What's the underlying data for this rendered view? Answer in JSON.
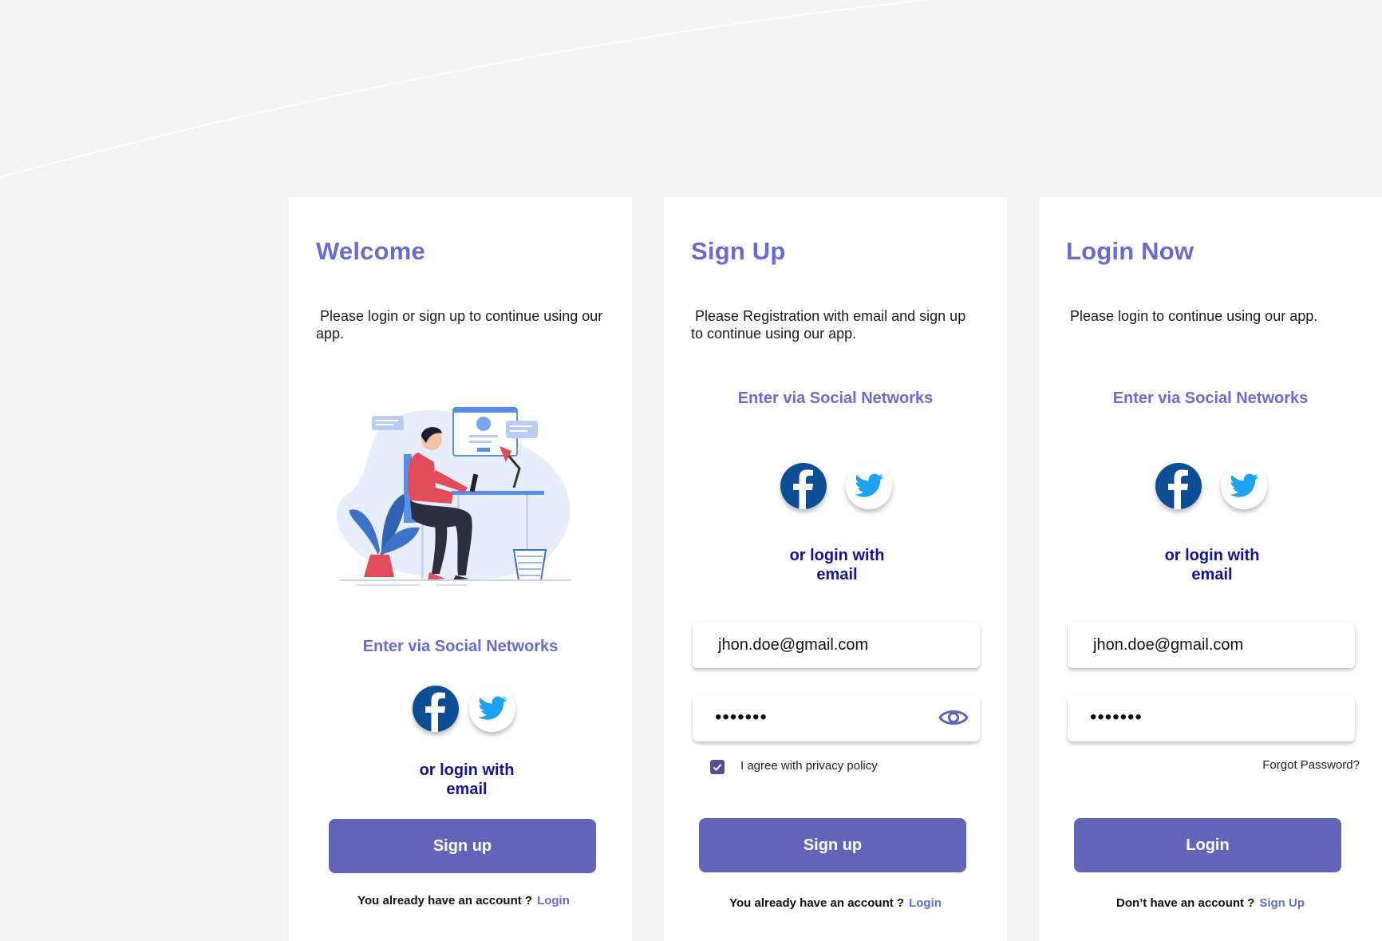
{
  "welcome": {
    "title": "Welcome",
    "subtitle": " Please login or sign up to continue using our app.",
    "illustration": "person-at-desk-illustration",
    "social_heading": "Enter via Social Networks",
    "or_login": "or login with email",
    "primary_button": "Sign up",
    "footer_text": "You already have an account ?",
    "footer_link": "Login"
  },
  "signup": {
    "title": "Sign Up",
    "subtitle": " Please Registration with email and sign up to continue using our app.",
    "social_heading": "Enter via Social Networks",
    "or_login": "or login with email",
    "email_value": "jhon.doe@gmail.com",
    "password_mask": "•••••••",
    "password_toggle_icon": "eye-icon",
    "privacy_checked": true,
    "privacy_label": "I agree with privacy policy",
    "primary_button": "Sign up",
    "footer_text": "You already have an account ?",
    "footer_link": "Login"
  },
  "login": {
    "title": "Login Now",
    "subtitle": " Please login to continue using our app.",
    "social_heading": "Enter via Social Networks",
    "or_login": "or login with email",
    "email_value": "jhon.doe@gmail.com",
    "password_mask": "•••••••",
    "forgot_password": "Forgot Password?",
    "primary_button": "Login",
    "footer_text": "Don’t  have an account ?",
    "footer_link": "Sign Up"
  },
  "colors": {
    "accent": "#6a6bd1",
    "button": "#6264b9",
    "dark_blue": "#14138f",
    "facebook": "#0d4d94",
    "twitter": "#1da1f2",
    "background": "#f4f4f4"
  },
  "icons": {
    "facebook": "facebook-icon",
    "twitter": "twitter-icon"
  }
}
